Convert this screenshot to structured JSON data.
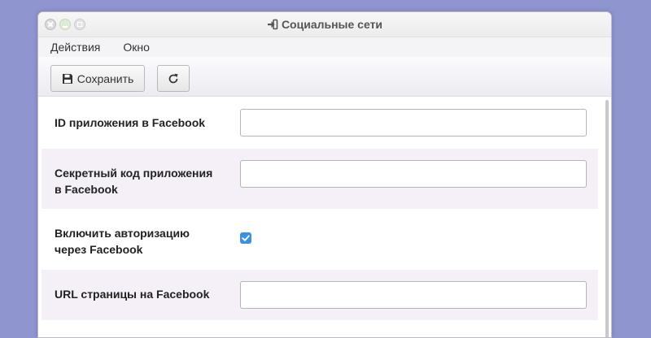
{
  "window": {
    "title": "Социальные сети",
    "title_icon": "sign-in-icon",
    "controls": [
      "close-icon",
      "minimize-icon",
      "maximize-icon"
    ]
  },
  "menu": {
    "items": [
      {
        "label": "Действия"
      },
      {
        "label": "Окно"
      }
    ]
  },
  "toolbar": {
    "save_label": "Сохранить",
    "save_icon": "floppy-disk-icon",
    "refresh_icon": "refresh-icon"
  },
  "form": {
    "fields": [
      {
        "label": "ID приложения в Facebook",
        "type": "text",
        "value": "",
        "shaded": false
      },
      {
        "label": "Секретный код приложения в Facebook",
        "type": "text",
        "value": "",
        "shaded": true
      },
      {
        "label": "Включить авторизацию через Facebook",
        "type": "checkbox",
        "checked": true,
        "shaded": false
      },
      {
        "label": "URL страницы на Facebook",
        "type": "text",
        "value": "",
        "shaded": true
      }
    ]
  },
  "colors": {
    "desktop_background": "#8f96cf",
    "shaded_row": "#f5eff8",
    "checkbox_accent": "#3d8fe0"
  }
}
